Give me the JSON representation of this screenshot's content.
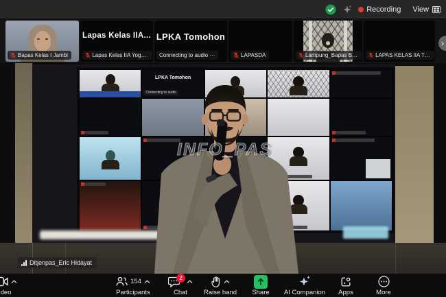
{
  "topbar": {
    "recording_label": "Recording",
    "view_label": "View"
  },
  "filmstrip": {
    "tiles": [
      {
        "name_label": "Bapas Kelas I Jambi",
        "muted": true
      },
      {
        "center_name": "Lapas Kelas IIA...",
        "name_label": "Lapas Kelas IIA Yogyak...",
        "muted": true
      },
      {
        "center_name": "LPKA Tomohon",
        "name_label": "Connecting to audio ···",
        "muted": false
      },
      {
        "name_label": "LAPASDA",
        "muted": true
      },
      {
        "name_label": "Lampung_Bapas Band...",
        "muted": true
      },
      {
        "name_label": "LAPAS KELAS IIA TEM...",
        "muted": true
      }
    ]
  },
  "main": {
    "speaker_label": "Ditjenpas_Eric Hidayat",
    "watermark": "INFO_PAS",
    "tv": {
      "row1_center_name": "LPKA Tomohon",
      "row1_connecting": "Connecting to audio"
    }
  },
  "toolbar": {
    "video_label": "ideo",
    "participants_label": "Participants",
    "participants_count": "154",
    "chat_label": "Chat",
    "chat_badge": "2",
    "raise_hand_label": "Raise hand",
    "share_label": "Share",
    "ai_label": "AI Companion",
    "apps_label": "Apps",
    "more_label": "More"
  },
  "colors": {
    "accent_green": "#23c162",
    "badge_red": "#e8173d",
    "record_red": "#e53935",
    "mic_red": "#d93025"
  }
}
